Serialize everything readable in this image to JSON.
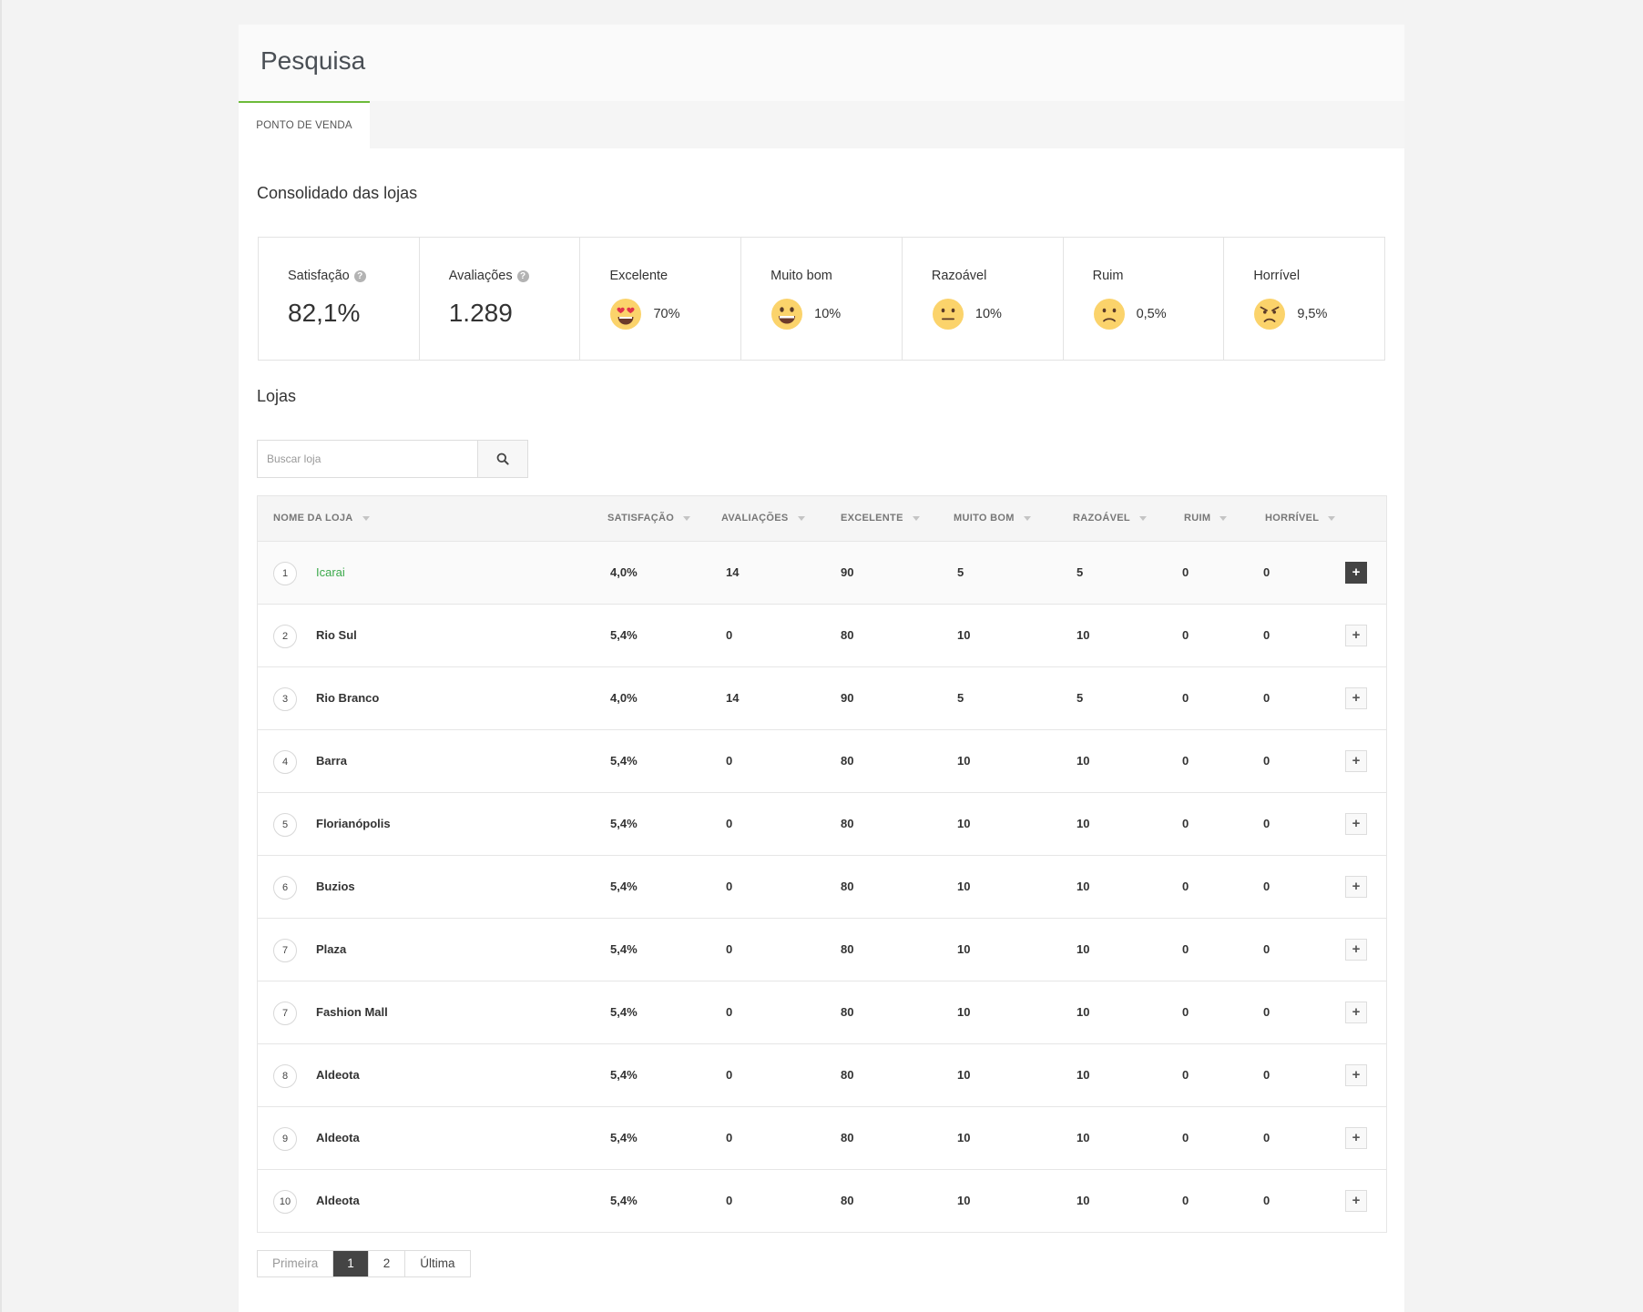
{
  "page": {
    "title": "Pesquisa"
  },
  "tabs": [
    {
      "label": "PONTO DE VENDA"
    }
  ],
  "summary": {
    "title": "Consolidado das lojas",
    "satisfaction": {
      "label": "Satisfação",
      "value": "82,1%"
    },
    "reviews": {
      "label": "Avaliações",
      "value": "1.289"
    },
    "ratings": [
      {
        "label": "Excelente",
        "pct": "70%",
        "icon": "heart-eyes-emoji-icon"
      },
      {
        "label": "Muito bom",
        "pct": "10%",
        "icon": "grinning-emoji-icon"
      },
      {
        "label": "Razoável",
        "pct": "10%",
        "icon": "neutral-emoji-icon"
      },
      {
        "label": "Ruim",
        "pct": "0,5%",
        "icon": "frowning-emoji-icon"
      },
      {
        "label": "Horrível",
        "pct": "9,5%",
        "icon": "angry-emoji-icon"
      }
    ]
  },
  "stores": {
    "title": "Lojas",
    "search_placeholder": "Buscar loja",
    "columns": [
      "NOME DA LOJA",
      "SATISFAÇÃO",
      "AVALIAÇÕES",
      "EXCELENTE",
      "MUITO BOM",
      "RAZOÁVEL",
      "RUIM",
      "HORRÍVEL"
    ],
    "rows": [
      {
        "rank": "1",
        "name": "Icarai",
        "satisfaction": "4,0%",
        "reviews": "14",
        "excelente": "90",
        "muito_bom": "5",
        "razoavel": "5",
        "ruim": "0",
        "horrivel": "0"
      },
      {
        "rank": "2",
        "name": "Rio Sul",
        "satisfaction": "5,4%",
        "reviews": "0",
        "excelente": "80",
        "muito_bom": "10",
        "razoavel": "10",
        "ruim": "0",
        "horrivel": "0"
      },
      {
        "rank": "3",
        "name": "Rio Branco",
        "satisfaction": "4,0%",
        "reviews": "14",
        "excelente": "90",
        "muito_bom": "5",
        "razoavel": "5",
        "ruim": "0",
        "horrivel": "0"
      },
      {
        "rank": "4",
        "name": "Barra",
        "satisfaction": "5,4%",
        "reviews": "0",
        "excelente": "80",
        "muito_bom": "10",
        "razoavel": "10",
        "ruim": "0",
        "horrivel": "0"
      },
      {
        "rank": "5",
        "name": "Florianópolis",
        "satisfaction": "5,4%",
        "reviews": "0",
        "excelente": "80",
        "muito_bom": "10",
        "razoavel": "10",
        "ruim": "0",
        "horrivel": "0"
      },
      {
        "rank": "6",
        "name": "Buzios",
        "satisfaction": "5,4%",
        "reviews": "0",
        "excelente": "80",
        "muito_bom": "10",
        "razoavel": "10",
        "ruim": "0",
        "horrivel": "0"
      },
      {
        "rank": "7",
        "name": "Plaza",
        "satisfaction": "5,4%",
        "reviews": "0",
        "excelente": "80",
        "muito_bom": "10",
        "razoavel": "10",
        "ruim": "0",
        "horrivel": "0"
      },
      {
        "rank": "7",
        "name": "Fashion Mall",
        "satisfaction": "5,4%",
        "reviews": "0",
        "excelente": "80",
        "muito_bom": "10",
        "razoavel": "10",
        "ruim": "0",
        "horrivel": "0"
      },
      {
        "rank": "8",
        "name": "Aldeota",
        "satisfaction": "5,4%",
        "reviews": "0",
        "excelente": "80",
        "muito_bom": "10",
        "razoavel": "10",
        "ruim": "0",
        "horrivel": "0"
      },
      {
        "rank": "9",
        "name": "Aldeota",
        "satisfaction": "5,4%",
        "reviews": "0",
        "excelente": "80",
        "muito_bom": "10",
        "razoavel": "10",
        "ruim": "0",
        "horrivel": "0"
      },
      {
        "rank": "10",
        "name": "Aldeota",
        "satisfaction": "5,4%",
        "reviews": "0",
        "excelente": "80",
        "muito_bom": "10",
        "razoavel": "10",
        "ruim": "0",
        "horrivel": "0"
      }
    ],
    "expand_label": "+"
  },
  "pagination": {
    "first": "Primeira",
    "pages": [
      "1",
      "2"
    ],
    "current": "1",
    "last": "Última"
  },
  "colors": {
    "accent": "#6dbb3a",
    "link": "#3ba94b",
    "dark_button": "#444444",
    "emoji_face": "#fbd36b"
  }
}
